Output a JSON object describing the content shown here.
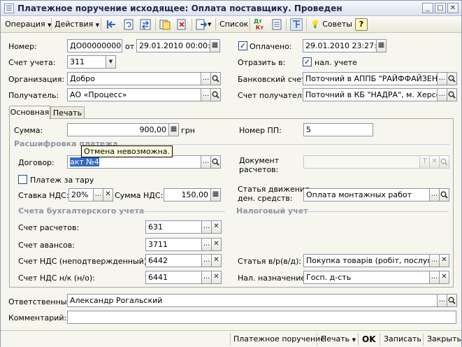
{
  "window": {
    "title": "Платежное поручение исходящее: Оплата поставщику. Проведен",
    "btn_min": "_",
    "btn_max": "□",
    "btn_close": "✕"
  },
  "toolbar": {
    "operation": "Операция",
    "actions": "Действия",
    "list": "Список",
    "dt_kt": "Дт Кт",
    "tips": "Советы",
    "help": "?"
  },
  "header": {
    "number_label": "Номер:",
    "number_value": "ДО000000005",
    "from_label": "от",
    "date_value": "29.01.2010 00:00:00",
    "paid_label": "Оплачено:",
    "paid_date": "29.01.2010 23:27:29",
    "account_label": "Счет учета:",
    "account_value": "311",
    "reflect_label": "Отразить в:",
    "tax_label": "нал. учете",
    "org_label": "Организация:",
    "org_value": "Добро",
    "bank_label": "Банковский счет:",
    "bank_value": "Поточний в АППБ \"РАЙФФАЙЗЕН Б",
    "recipient_label": "Получатель:",
    "recipient_value": "АО «Процесс»",
    "recipient_acc_label": "Счет получателя:",
    "recipient_acc_value": "Поточний в КБ \"НАДРА\", м. Херсон"
  },
  "tabs": {
    "main": "Основная",
    "print": "Печать"
  },
  "main": {
    "sum_label": "Сумма:",
    "sum_value": "900,00",
    "currency": "грн",
    "pp_label": "Номер ПП:",
    "pp_value": "5",
    "decoding_group": "Расшифровка платежа",
    "tooltip": "Отмена невозможна.",
    "contract_label": "Договор:",
    "contract_value": "акт №4",
    "doc_label_1": "Документ",
    "doc_label_2": "расчетов:",
    "doc_btn_t": "T",
    "tare_label": "Платеж за тару",
    "vat_rate_label": "Ставка НДС:",
    "vat_rate_value": "20%",
    "vat_sum_label": "Сумма НДС:",
    "vat_sum_value": "150,00",
    "cashflow_label_1": "Статья движения",
    "cashflow_label_2": "ден. средств:",
    "cashflow_value": "Оплата монтажных работ",
    "accounts_group": "Счета бухгалтерского учета",
    "tax_group": "Налоговый учет",
    "settle_label": "Счет расчетов:",
    "settle_value": "631",
    "advance_label": "Счет авансов:",
    "advance_value": "3711",
    "vat_uncf_label": "Счет НДС (неподтвержденный):",
    "vat_uncf_value": "6442",
    "vat_nk_label": "Счет НДС н/к (н/о):",
    "vat_nk_value": "6441",
    "article_label": "Статья в/р(в/д):",
    "article_value": "Покупка товарів (робіт, послуг)",
    "tax_purpose_label": "Нал. назначение:",
    "tax_purpose_value": "Госп. д-сть"
  },
  "footer": {
    "responsible_label": "Ответственный:",
    "responsible_value": "Александр Рогальский",
    "comment_label": "Комментарий:",
    "comment_value": ""
  },
  "bottom": {
    "payment_order": "Платежное поручение",
    "print": "Печать",
    "ok": "OK",
    "save": "Записать",
    "close": "Закрыть"
  },
  "glyphs": {
    "dots": "...",
    "search": "🔍",
    "clear": "✕",
    "calendar": "▦",
    "arrow": "▼",
    "check": "✓"
  }
}
